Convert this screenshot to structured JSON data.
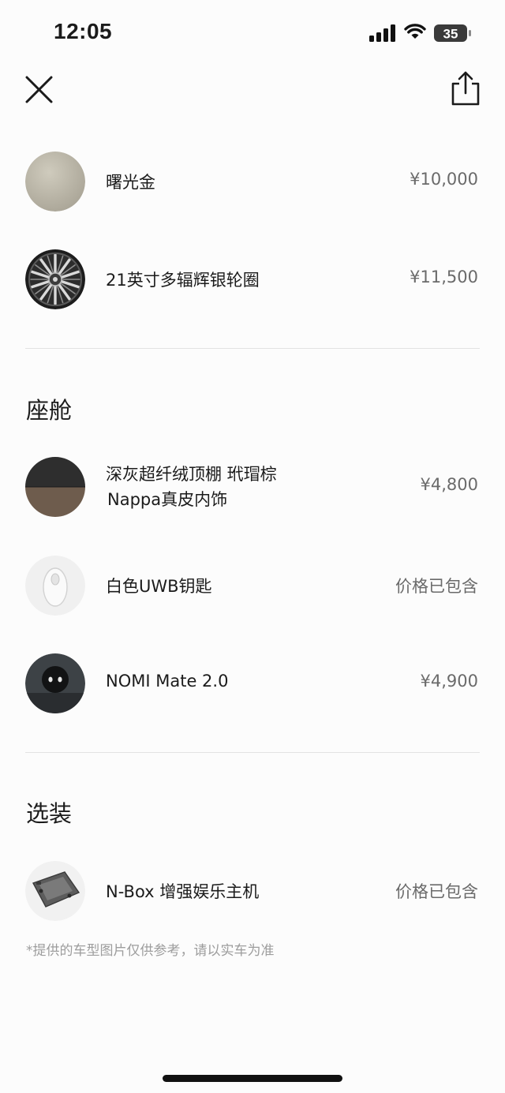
{
  "status_bar": {
    "time": "12:05",
    "battery": "35"
  },
  "header": {
    "close_icon": "close-icon",
    "share_icon": "share-icon"
  },
  "exterior": {
    "items": [
      {
        "label": "曙光金",
        "price": "¥10,000",
        "icon": "gold-paint-swatch"
      },
      {
        "label": "21英寸多辐辉银轮圈",
        "price": "¥11,500",
        "icon": "wheel-rim"
      }
    ]
  },
  "cabin": {
    "title": "座舱",
    "items": [
      {
        "label_line1": "深灰超纤绒顶棚 玳瑁棕",
        "label_line2": "Nappa真皮内饰",
        "price": "¥4,800",
        "icon": "interior-swatch"
      },
      {
        "label": "白色UWB钥匙",
        "price": "价格已包含",
        "icon": "uwb-key"
      },
      {
        "label": "NOMI Mate 2.0",
        "price": "¥4,900",
        "icon": "nomi-robot"
      }
    ]
  },
  "options": {
    "title": "选装",
    "items": [
      {
        "label": "N-Box 增强娱乐主机",
        "price": "价格已包含",
        "icon": "nbox-device"
      }
    ]
  },
  "footnote": "*提供的车型图片仅供参考，请以实车为准",
  "colors": {
    "background": "#fcfcfc",
    "text": "#1b1b1b",
    "price_text": "#6a6a6a",
    "footnote_text": "#9d9d9d",
    "divider": "#e3e3e3"
  }
}
